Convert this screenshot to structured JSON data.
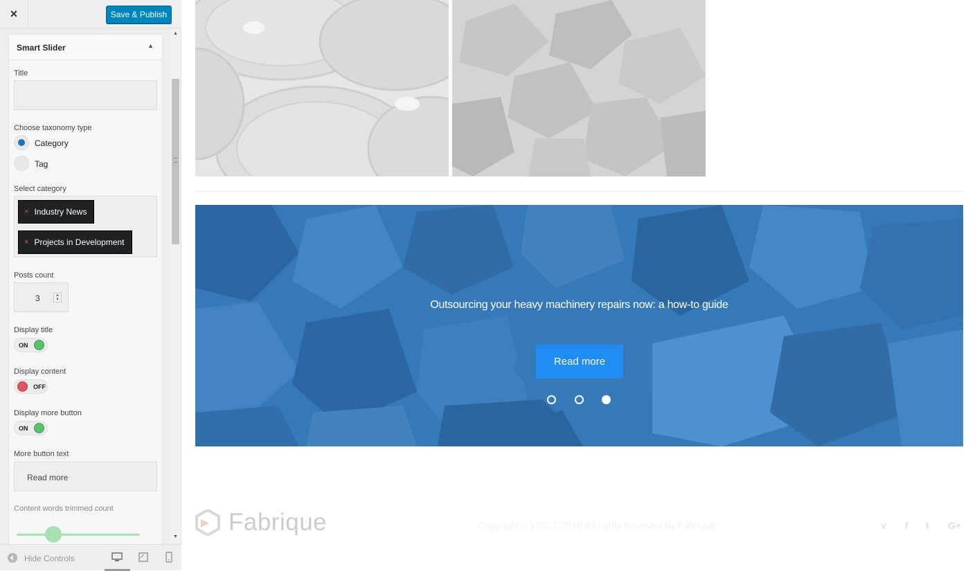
{
  "topbar": {
    "close_label": "×",
    "publish_label": "Save & Publish"
  },
  "widget": {
    "title": "Smart Slider",
    "toggle_icon": "▲",
    "fields": {
      "title_label": "Title",
      "title_value": "",
      "taxonomy_label": "Choose taxonomy type",
      "taxonomy_options": [
        "Category",
        "Tag"
      ],
      "taxonomy_selected": "Category",
      "category_label": "Select category",
      "categories_selected": [
        "Industry News",
        "Projects in Development"
      ],
      "tag_remove_icon": "×",
      "posts_count_label": "Posts count",
      "posts_count_value": "3",
      "display_title_label": "Display title",
      "display_title_state": "ON",
      "display_content_label": "Display content",
      "display_content_state": "OFF",
      "display_more_button_label": "Display more button",
      "display_more_button_state": "ON",
      "more_button_text_label": "More button text",
      "more_button_text_value": "Read more",
      "trim_label": "Content words trimmed count"
    }
  },
  "footer": {
    "hide_controls_label": "Hide Controls",
    "devices": [
      "desktop-icon",
      "tablet-icon",
      "mobile-icon"
    ],
    "active_device": "desktop"
  },
  "preview": {
    "slide": {
      "title": "Outsourcing your heavy machinery repairs now: a how-to guide",
      "button_label": "Read more",
      "dots": 3,
      "active_dot": 3
    },
    "site_footer": {
      "logo_text": "Fabrique",
      "copyright": "Copyright (c) 2017-2016 All rights reserved by Fabrique",
      "social": [
        "vimeo-icon",
        "facebook-icon",
        "twitter-icon",
        "google-plus-icon"
      ]
    }
  },
  "colors": {
    "publish": "#0085ba",
    "slider_overlay": "#3a7fbe",
    "slide_button": "#1e8cf0",
    "toggle_on": "#56c26b",
    "toggle_off": "#e25563"
  }
}
